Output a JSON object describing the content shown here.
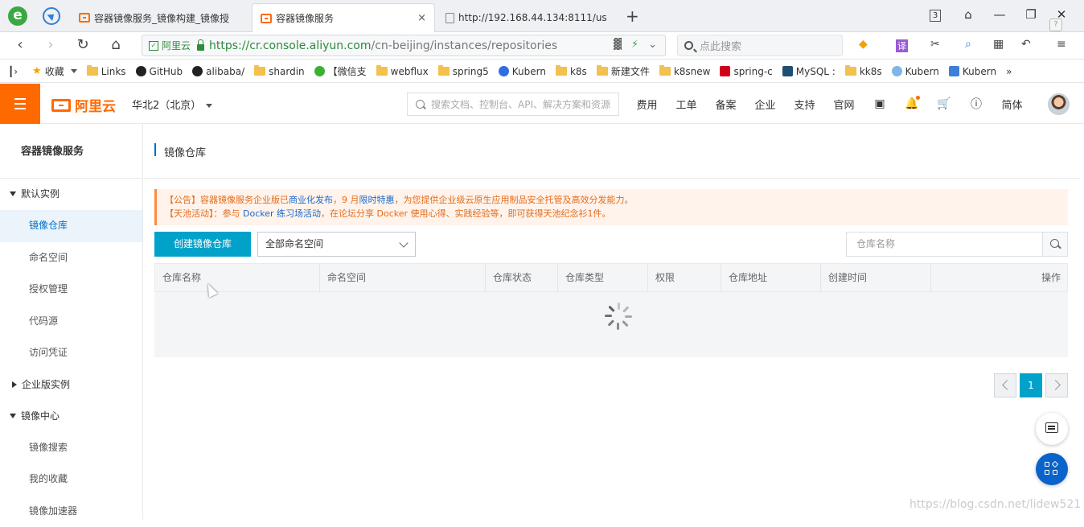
{
  "browser": {
    "tabs": [
      {
        "title": "容器镜像服务_镜像构建_镜像授",
        "icon": "aliyun-icon"
      },
      {
        "title": "容器镜像服务",
        "icon": "aliyun-icon",
        "active": true
      },
      {
        "title": "http://192.168.44.134:8111/us",
        "icon": "page-icon"
      }
    ],
    "tab_close": "×",
    "new_tab": "+",
    "tab_count": "3",
    "address": {
      "cert_label": "阿里云",
      "url_scheme": "https://",
      "url_host": "cr.console.aliyun.com",
      "url_path": "/cn-beijing/instances/repositories"
    },
    "search_placeholder": "点此搜索",
    "bookmarks": [
      {
        "label": "收藏",
        "type": "star"
      },
      {
        "label": "Links",
        "type": "folder"
      },
      {
        "label": "GitHub",
        "type": "github"
      },
      {
        "label": "alibaba/",
        "type": "github"
      },
      {
        "label": "shardin",
        "type": "folder"
      },
      {
        "label": "【微信支",
        "type": "wechat"
      },
      {
        "label": "webflux",
        "type": "folder"
      },
      {
        "label": "spring5",
        "type": "folder"
      },
      {
        "label": "Kubern",
        "type": "k8s"
      },
      {
        "label": "k8s",
        "type": "folder"
      },
      {
        "label": "新建文件",
        "type": "folder"
      },
      {
        "label": "k8snew",
        "type": "folder"
      },
      {
        "label": "spring-c",
        "type": "red"
      },
      {
        "label": "MySQL :",
        "type": "mysql"
      },
      {
        "label": "kk8s",
        "type": "folder"
      },
      {
        "label": "Kubern",
        "type": "cloud"
      },
      {
        "label": "Kubern",
        "type": "blue"
      }
    ],
    "bookmarks_more": "»"
  },
  "console": {
    "logo_text": "阿里云",
    "region": "华北2（北京）",
    "search_placeholder": "搜索文档、控制台、API、解决方案和资源",
    "links": [
      "费用",
      "工单",
      "备案",
      "企业",
      "支持",
      "官网"
    ],
    "lang": "简体"
  },
  "sidebar": {
    "title": "容器镜像服务",
    "groups": [
      {
        "label": "默认实例",
        "expanded": true,
        "items": [
          "镜像仓库",
          "命名空间",
          "授权管理",
          "代码源",
          "访问凭证"
        ]
      },
      {
        "label": "企业版实例",
        "expanded": false,
        "items": []
      },
      {
        "label": "镜像中心",
        "expanded": true,
        "items": [
          "镜像搜索",
          "我的收藏",
          "镜像加速器"
        ]
      }
    ],
    "active_item": "镜像仓库"
  },
  "main": {
    "breadcrumb": "镜像仓库",
    "notice": {
      "line1_a": "【公告】容器镜像服务企业版已",
      "line1_link1": "商业化发布",
      "line1_b": "，9 月",
      "line1_link2": "限时特惠",
      "line1_c": "，为您提供企业级云原生应用制品安全托管及高效分发能力。",
      "line2_a": "【天池活动】：参与 ",
      "line2_link": "Docker 练习场活动",
      "line2_b": "，在论坛分享 Docker 使用心得、实践经验等，即可获得天池纪念衫1件。"
    },
    "create_button": "创建镜像仓库",
    "namespace_select": "全部命名空间",
    "repo_search_placeholder": "仓库名称",
    "table": {
      "columns": [
        "仓库名称",
        "命名空间",
        "仓库状态",
        "仓库类型",
        "权限",
        "仓库地址",
        "创建时间",
        "操作"
      ],
      "rows": [],
      "loading": true
    },
    "pagination": {
      "current": "1"
    }
  },
  "watermark": "https://blog.csdn.net/lidew521",
  "colors": {
    "brand": "#ff6a00",
    "primary": "#00a2ca",
    "link": "#0070cc"
  }
}
